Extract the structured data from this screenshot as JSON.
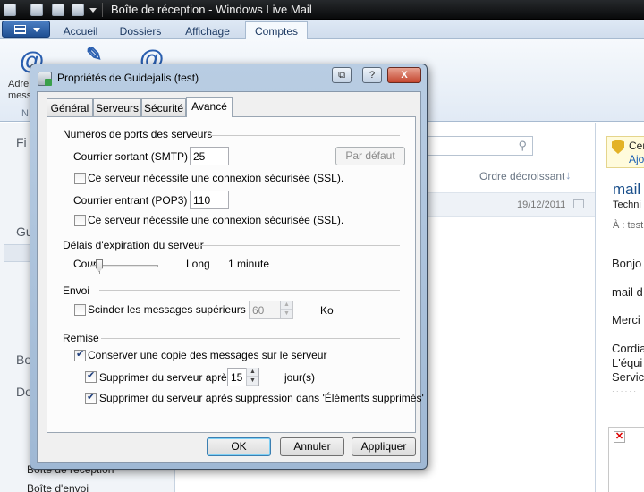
{
  "window": {
    "title": "Boîte de réception - Windows Live Mail"
  },
  "ribbon": {
    "tabs": [
      {
        "label": "Accueil"
      },
      {
        "label": "Dossiers"
      },
      {
        "label": "Affichage"
      },
      {
        "label": "Comptes"
      }
    ],
    "group1_line1": "Adre",
    "group1_line2": "mess",
    "group_label": "N"
  },
  "left_pane": {
    "head1": "Fi",
    "head2": "Gu",
    "head3": "Boi",
    "head4": "Do",
    "item_boite_reception": "Boîte de réception",
    "item_boite_envoi": "Boîte d'envoi"
  },
  "message_list": {
    "sort_label": "Ordre décroissant",
    "date": "19/12/2011"
  },
  "reading_pane": {
    "warning_line1": "Cer",
    "warning_line2": "Ajo",
    "title": "mail",
    "subtitle": "Techni",
    "to": "À : test",
    "p1": "Bonjo",
    "p2": "mail d",
    "p3": "Merci",
    "p4a": "Cordia",
    "p4b": "L'équi",
    "p4c": "Servic",
    "dots": "· · · · · ·"
  },
  "dialog": {
    "title": "Propriétés de Guidejalis (test)",
    "caption_buttons": {
      "minimize": "⧉",
      "help": "?",
      "close": "X"
    },
    "tabs": [
      {
        "label": "Général"
      },
      {
        "label": "Serveurs"
      },
      {
        "label": "Sécurité"
      },
      {
        "label": "Avancé"
      }
    ],
    "ports": {
      "section": "Numéros de ports des serveurs",
      "smtp_label": "Courrier sortant (SMTP) :",
      "smtp_value": "25",
      "default_button": "Par défaut",
      "smtp_ssl": "Ce serveur nécessite une connexion sécurisée (SSL).",
      "pop3_label": "Courrier entrant (POP3) :",
      "pop3_value": "110",
      "pop3_ssl": "Ce serveur nécessite une connexion sécurisée (SSL)."
    },
    "timeout": {
      "section": "Délais d'expiration du serveur",
      "short": "Court",
      "long": "Long",
      "value": "1 minute",
      "level": 0.1
    },
    "sending": {
      "section": "Envoi",
      "split_label": "Scinder les messages supérieurs à",
      "split_value": "60",
      "unit": "Ko"
    },
    "delivery": {
      "section": "Remise",
      "keep_copy": "Conserver une copie des messages sur le serveur",
      "remove_after": "Supprimer du serveur après",
      "days_value": "15",
      "days_unit": "jour(s)",
      "remove_deleted": "Supprimer du serveur après suppression dans 'Éléments supprimés'"
    },
    "buttons": {
      "ok": "OK",
      "cancel": "Annuler",
      "apply": "Appliquer"
    }
  }
}
